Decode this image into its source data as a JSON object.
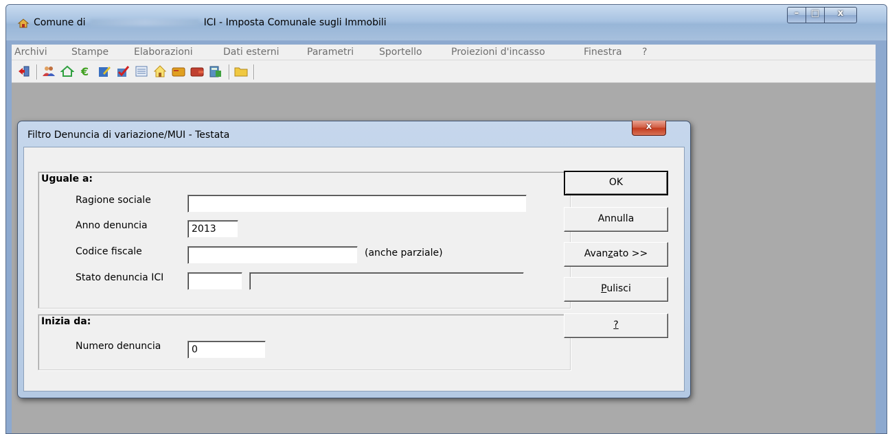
{
  "window": {
    "title_prefix": "Comune di",
    "title_suffix": "ICI - Imposta Comunale sugli Immobili",
    "minimize": "–",
    "maximize": "□",
    "close": "x"
  },
  "menu": [
    "Archivi",
    "Stampe",
    "Elaborazioni",
    "Dati esterni",
    "Parametri",
    "Sportello",
    "Proiezioni d'incasso",
    "Finestra",
    "?"
  ],
  "toolbar_icons": [
    "exit-icon",
    "people-icon",
    "house-icon",
    "euro-icon",
    "edit-icon",
    "checkmark-icon",
    "list-icon",
    "home-icon",
    "card-icon",
    "wallet-icon",
    "calculator-icon",
    "folder-icon"
  ],
  "dialog": {
    "title": "Filtro Denuncia di variazione/MUI - Testata",
    "close": "x",
    "group_equal": "Uguale a:",
    "ragione_sociale_label": "Ragione sociale",
    "ragione_sociale_value": "",
    "anno_label": "Anno denuncia",
    "anno_value": "2013",
    "codice_label": "Codice fiscale",
    "codice_value": "",
    "codice_hint": "(anche parziale)",
    "stato_label": "Stato denuncia ICI",
    "stato_code_value": "",
    "stato_desc_value": "",
    "group_start": "Inizia da:",
    "numero_label": "Numero denuncia",
    "numero_value": "0",
    "btn_ok": "OK",
    "btn_annulla": "Annulla",
    "btn_avanzato_pre": "Avan",
    "btn_avanzato_u": "z",
    "btn_avanzato_post": "ato >>",
    "btn_pulisci_u": "P",
    "btn_pulisci_post": "ulisci",
    "btn_help": "?"
  }
}
